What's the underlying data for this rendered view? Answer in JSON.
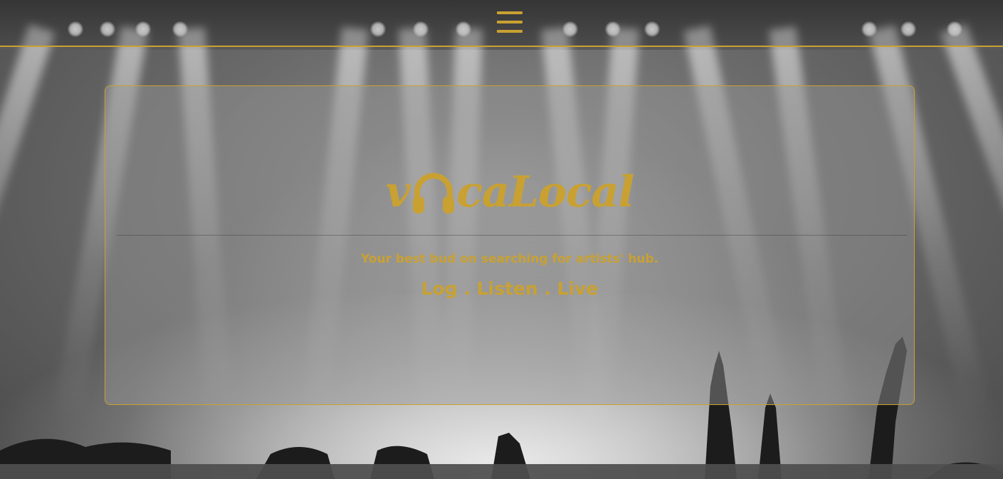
{
  "brand": {
    "logo_text_start": "v",
    "logo_text_end": "caLocal",
    "logo_icon": "headphones-icon",
    "tagline": "Your best bud on searching for artists' hub.",
    "motto": "Log . Listen . Live"
  },
  "navbar": {
    "menu_icon": "hamburger-menu-icon"
  },
  "colors": {
    "accent": "#c9a132",
    "panel": "#969696"
  }
}
